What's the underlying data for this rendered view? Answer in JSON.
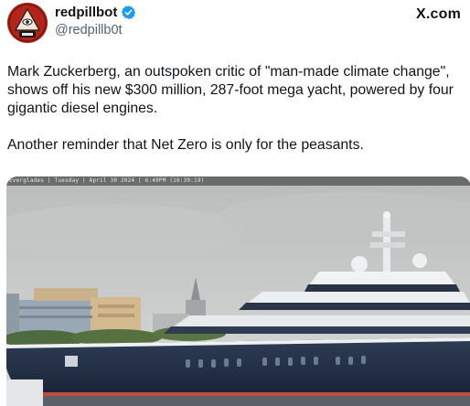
{
  "header": {
    "display_name": "redpillbot",
    "handle": "@redpillb0t",
    "brand": "X.com",
    "verified": true
  },
  "tweet": {
    "paragraph_1": "Mark Zuckerberg, an outspoken critic of \"man-made climate change\", shows off his new $300 million, 287-foot mega yacht, powered by four gigantic diesel engines.",
    "paragraph_2": "Another reminder that Net Zero is only for the peasants."
  },
  "media": {
    "overlay_text": "Everglades | Tuesday | April 30 2024 | 6:40PM (16:39:19)"
  },
  "colors": {
    "text": "#0f1419",
    "secondary_text": "#536471",
    "verified_badge": "#1d9bf0",
    "avatar_bg": "#b3241c"
  },
  "icons": {
    "verified": "verified-badge-icon",
    "avatar": "avatar-icon"
  }
}
